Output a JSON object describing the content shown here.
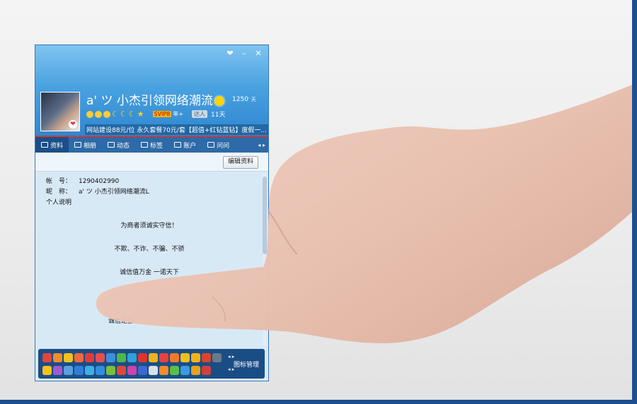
{
  "window": {
    "controls": [
      "❤",
      "–",
      "✕"
    ]
  },
  "profile": {
    "nickname": "a' ツ 小杰引领网络潮流",
    "score": "1250",
    "score_suffix": "′ 天",
    "svip": "SVIP8",
    "svip_suffix": "年+",
    "daren": "达人",
    "days": "11天",
    "signature": "网站建设88元/位   永久套餐70元/套【超值+红钻蓝钻】度假一..."
  },
  "tabs": [
    {
      "label": "资料",
      "icon": "profile-card-icon"
    },
    {
      "label": "相册",
      "icon": "photo-album-icon"
    },
    {
      "label": "动态",
      "icon": "feed-icon"
    },
    {
      "label": "标签",
      "icon": "tag-icon"
    },
    {
      "label": "账户",
      "icon": "wallet-icon"
    },
    {
      "label": "问问",
      "icon": "question-icon"
    }
  ],
  "tab_arrows": "◂ ▸",
  "toolbar": {
    "edit_label": "编辑资料"
  },
  "info": {
    "account_label": "帐　号：",
    "account_value": "1290402990",
    "nick_label": "昵　称：",
    "nick_value": "a' ツ 小杰引领网络潮流L",
    "desc_label": "个人说明",
    "lines": [
      "为商者须诚实守信！",
      "不欺、不诈、不骗、不骄",
      "诚信值万金 一诺天下",
      "诚信是金"
    ]
  },
  "emoji": {
    "manage_label": "图标管理",
    "arrows": "◂ ▸",
    "row1_colors": [
      "#e2463a",
      "#f08c2a",
      "#f3c21b",
      "#f06a3a",
      "#e23b3b",
      "#e45050",
      "#3e8ee0",
      "#4bb84a",
      "#32a0d8",
      "#e0332f",
      "#f3b21b",
      "#e84040",
      "#f07a2a",
      "#f0c020",
      "#f3b21b",
      "#d9442e",
      "#6a7a8a"
    ],
    "row2_colors": [
      "#f3c21b",
      "#a05ad0",
      "#5aa0e0",
      "#2f7fd8",
      "#3cb0e8",
      "#2f8fdf",
      "#7abf3a",
      "#e2463a",
      "#cc44aa",
      "#3a6ad0",
      "#d8e0ea",
      "#f08c2a",
      "#58c048",
      "#3c9be0",
      "#e8a020",
      "#d04040"
    ]
  }
}
